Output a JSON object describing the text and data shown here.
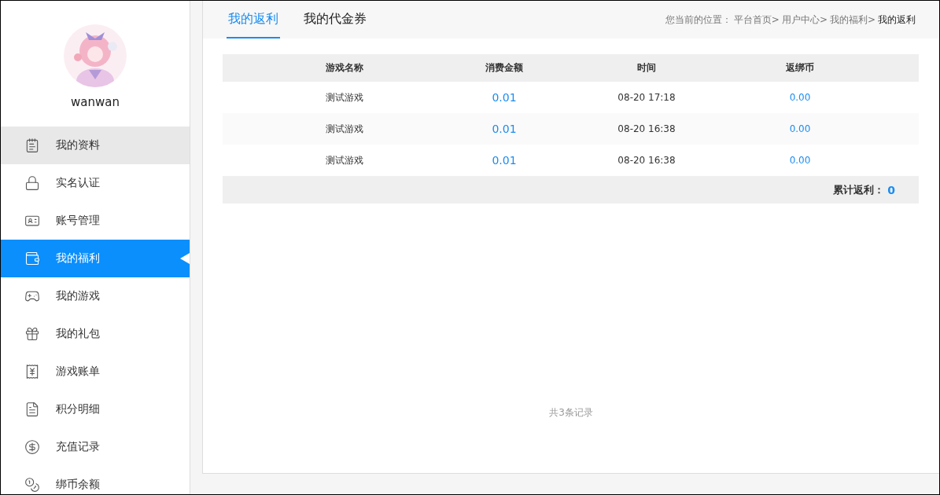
{
  "sidebar": {
    "username": "wanwan",
    "items": [
      {
        "label": "我的资料",
        "selected": false,
        "highlighted": true
      },
      {
        "label": "实名认证",
        "selected": false,
        "highlighted": false
      },
      {
        "label": "账号管理",
        "selected": false,
        "highlighted": false
      },
      {
        "label": "我的福利",
        "selected": true,
        "highlighted": false
      },
      {
        "label": "我的游戏",
        "selected": false,
        "highlighted": false
      },
      {
        "label": "我的礼包",
        "selected": false,
        "highlighted": false
      },
      {
        "label": "游戏账单",
        "selected": false,
        "highlighted": false
      },
      {
        "label": "积分明细",
        "selected": false,
        "highlighted": false
      },
      {
        "label": "充值记录",
        "selected": false,
        "highlighted": false
      },
      {
        "label": "绑币余额",
        "selected": false,
        "highlighted": false
      }
    ]
  },
  "tabs": [
    {
      "label": "我的返利",
      "selected": true
    },
    {
      "label": "我的代金券",
      "selected": false
    }
  ],
  "breadcrumb": {
    "prefix": "您当前的位置：",
    "items": [
      {
        "label": "平台首页>",
        "current": false
      },
      {
        "label": "用户中心>",
        "current": false
      },
      {
        "label": "我的福利>",
        "current": false
      },
      {
        "label": "我的返利",
        "current": true
      }
    ]
  },
  "table": {
    "columns": [
      "游戏名称",
      "消费金额",
      "时间",
      "返绑币"
    ],
    "rows": [
      [
        "测试游戏",
        "0.01",
        "08-20 17:18",
        "0.00"
      ],
      [
        "测试游戏",
        "0.01",
        "08-20 16:38",
        "0.00"
      ],
      [
        "测试游戏",
        "0.01",
        "08-20 16:38",
        "0.00"
      ]
    ],
    "total_label": "累计返利：",
    "total_value": "0"
  },
  "record_count": "共3条记录"
}
